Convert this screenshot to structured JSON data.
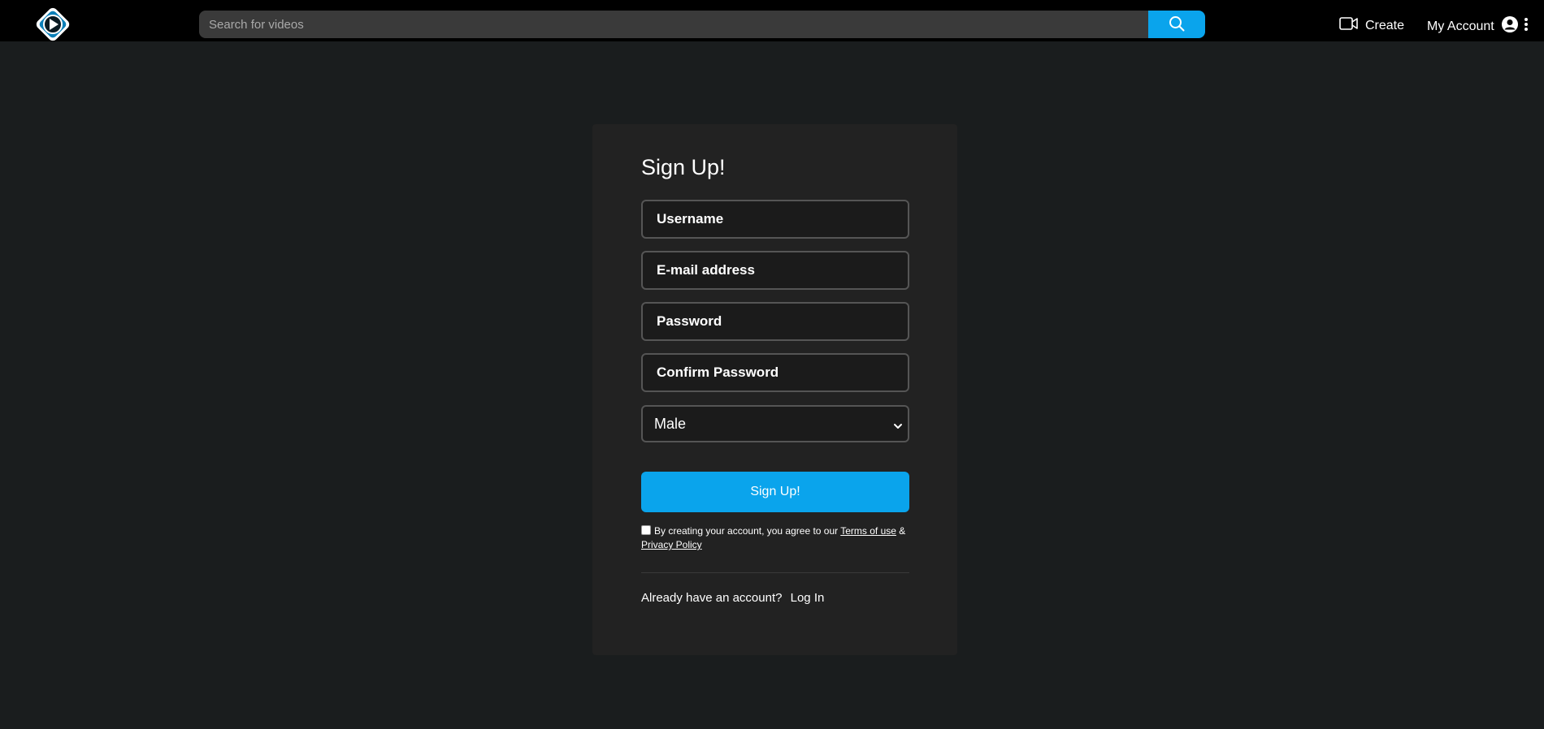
{
  "header": {
    "search_placeholder": "Search for videos",
    "create_label": "Create",
    "account_label": "My Account"
  },
  "form": {
    "title": "Sign Up!",
    "username_placeholder": "Username",
    "email_placeholder": "E-mail address",
    "password_placeholder": "Password",
    "confirm_placeholder": "Confirm Password",
    "gender_selected": "Male",
    "submit_label": "Sign Up!",
    "terms_prefix": "By creating your account, you agree to our ",
    "terms_link": "Terms of use",
    "terms_amp": " & ",
    "privacy_link": "Privacy Policy",
    "login_prompt": "Already have an account?",
    "login_link": "Log In"
  },
  "colors": {
    "accent": "#0aa4ec",
    "background": "#1a1d1e",
    "card": "#222222"
  },
  "icons": [
    "logo-icon",
    "search-icon",
    "video-camera-icon",
    "user-circle-icon",
    "kebab-menu-icon",
    "chevron-down-icon"
  ]
}
